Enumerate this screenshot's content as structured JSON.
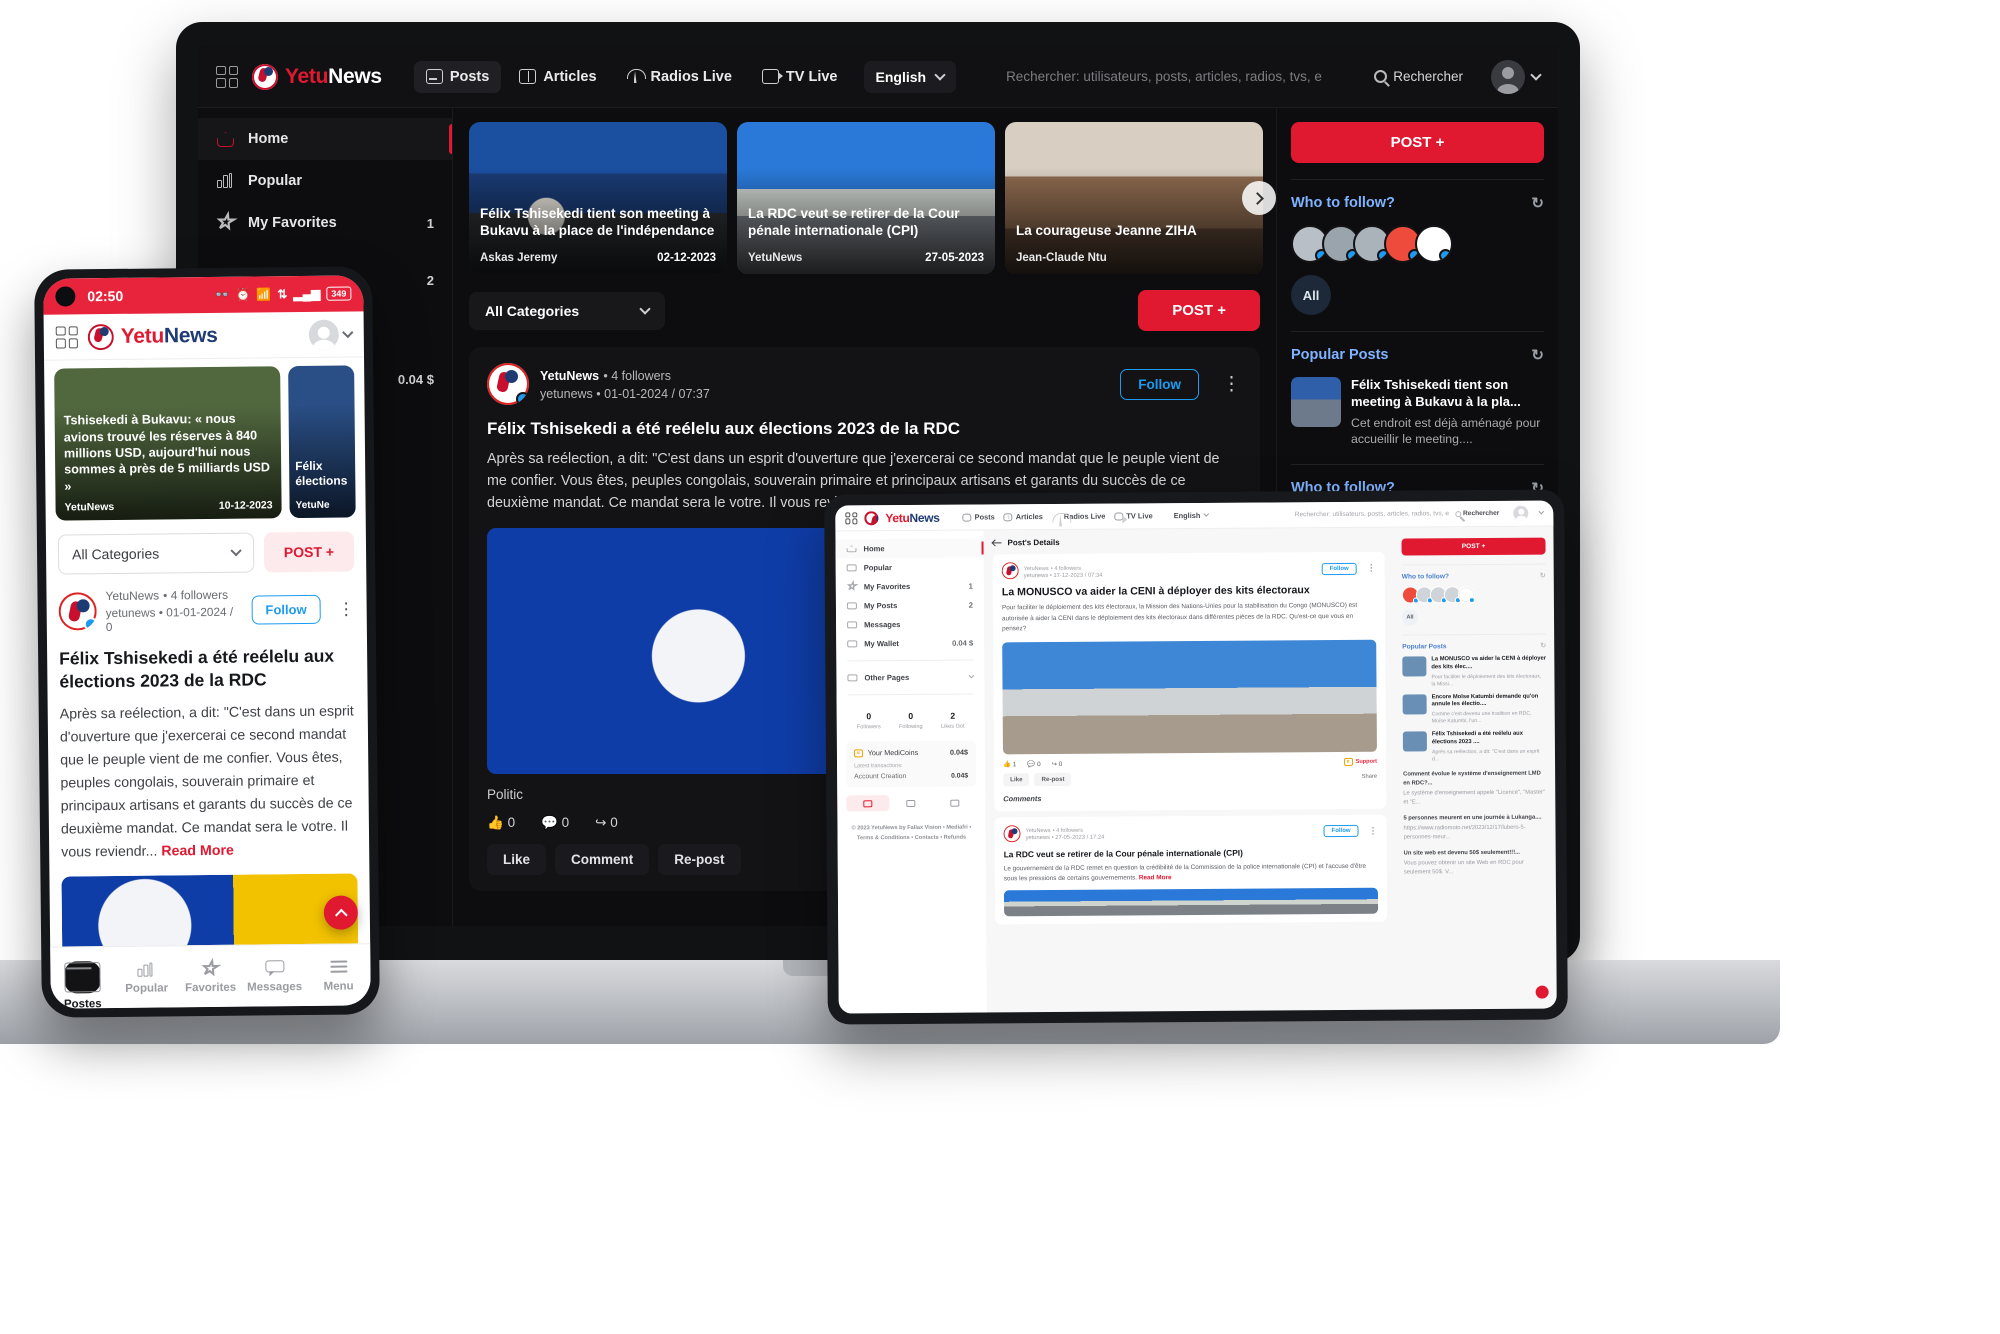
{
  "brand": {
    "name_part1": "Yetu",
    "name_part2": "News",
    "logo_icon": "yetunews-logo-icon"
  },
  "desktop": {
    "nav": [
      {
        "label": "Posts",
        "icon": "posts-icon",
        "active": true
      },
      {
        "label": "Articles",
        "icon": "articles-icon",
        "active": false
      },
      {
        "label": "Radios Live",
        "icon": "radio-icon",
        "active": false
      },
      {
        "label": "TV Live",
        "icon": "tv-icon",
        "active": false
      }
    ],
    "language": "English",
    "search": {
      "placeholder": "Rechercher: utilisateurs, posts, articles, radios, tvs, e",
      "button": "Rechercher"
    },
    "sidebar": [
      {
        "label": "Home",
        "icon": "home-icon",
        "count": "",
        "active": true
      },
      {
        "label": "Popular",
        "icon": "bars-icon",
        "count": "",
        "active": false
      },
      {
        "label": "My Favorites",
        "icon": "star-icon",
        "count": "1",
        "active": false
      },
      {
        "label": "My Posts",
        "icon": "card-icon",
        "count": "2",
        "active": false
      },
      {
        "label": "Messages",
        "icon": "message-icon",
        "count": "",
        "active": false
      },
      {
        "label": "My Wallet",
        "icon": "wallet-icon",
        "count": "0.04 $",
        "active": false
      }
    ],
    "stories": [
      {
        "title": "Félix Tshisekedi tient son meeting à Bukavu à la place de l'indépendance",
        "author": "Askas Jeremy",
        "date": "02-12-2023",
        "image": "img-rally"
      },
      {
        "title": "La RDC veut se retirer de la Cour pénale internationale (CPI)",
        "author": "YetuNews",
        "date": "27-05-2023",
        "image": "img-court"
      },
      {
        "title": "La courageuse Jeanne ZIHA",
        "author": "Jean-Claude Ntu",
        "date": "",
        "image": "img-room"
      }
    ],
    "category_filter": "All Categories",
    "post_button": "POST +",
    "feed_post": {
      "author": "YetuNews",
      "followers": "• 4 followers",
      "handle": "yetunews • 01-01-2024 / 07:37",
      "follow_label": "Follow",
      "title": "Félix Tshisekedi a été reélelu aux élections 2023 de la RDC",
      "body": "Après sa reélection, a dit: \"C'est dans un esprit d'ouverture que j'exercerai ce second mandat que le peuple vient de me confier. Vous êtes, peuples congolais, souverain primaire et principaux artisans et garants du succès de ce deuxième mandat. Ce mandat sera le votre. Il vous reviendr...",
      "read_more": "Read More",
      "category_tag": "Politic",
      "likes": "0",
      "comments": "0",
      "reposts": "0",
      "actions": [
        "Like",
        "Comment",
        "Re-post"
      ]
    },
    "right": {
      "post_button": "POST +",
      "who_to_follow": "Who to follow?",
      "all_label": "All",
      "popular_posts": "Popular Posts",
      "popular_item": {
        "title": "Félix Tshisekedi tient son meeting à Bukavu à la pla...",
        "excerpt": "Cet endroit est déjà aménagé pour accueillir le meeting...."
      },
      "who_to_follow2": "Who to follow?"
    }
  },
  "phone": {
    "status": {
      "time": "02:50",
      "battery": "349"
    },
    "hero": [
      {
        "title": "Tshisekedi à Bukavu: « nous avions trouvé les réserves à 840 millions USD, aujourd'hui nous sommes à près de 5 milliards USD »",
        "author": "YetuNews",
        "date": "10-12-2023"
      },
      {
        "title": "Félix élections",
        "author": "YetuNe",
        "date": ""
      }
    ],
    "category_filter": "All Categories",
    "post_button": "POST +",
    "post": {
      "author": "YetuNews",
      "followers": "• 4 followers",
      "handle": "yetunews • 01-01-2024 / 0",
      "follow_label": "Follow",
      "title": "Félix Tshisekedi a été reélelu aux élections 2023 de la RDC",
      "body": "Après sa reélection, a dit: \"C'est dans un esprit d'ouverture que j'exercerai ce second mandat que le peuple vient de me confier. Vous êtes, peuples congolais, souverain primaire et principaux artisans et garants du succès de ce deuxième mandat. Ce mandat sera le votre. Il vous reviendr...",
      "read_more": "Read More"
    },
    "tabs": [
      {
        "label": "Postes",
        "icon": "card-icon",
        "active": true
      },
      {
        "label": "Popular",
        "icon": "bars-icon",
        "active": false
      },
      {
        "label": "Favorites",
        "icon": "star-icon",
        "active": false
      },
      {
        "label": "Messages",
        "icon": "message-icon",
        "active": false
      },
      {
        "label": "Menu",
        "icon": "menu-icon",
        "active": false
      }
    ]
  },
  "tablet": {
    "nav": [
      {
        "label": "Posts",
        "icon": "posts-icon"
      },
      {
        "label": "Articles",
        "icon": "articles-icon"
      },
      {
        "label": "Radios Live",
        "icon": "radio-icon"
      },
      {
        "label": "TV Live",
        "icon": "tv-icon"
      }
    ],
    "language": "English",
    "search": {
      "placeholder": "Rechercher: utilisateurs, posts, articles, radios, tvs, e",
      "button": "Rechercher"
    },
    "sidebar": [
      {
        "label": "Home",
        "icon": "home-icon",
        "count": "",
        "active": true
      },
      {
        "label": "Popular",
        "icon": "bars-icon",
        "count": ""
      },
      {
        "label": "My Favorites",
        "icon": "star-icon",
        "count": "1"
      },
      {
        "label": "My Posts",
        "icon": "card-icon",
        "count": "2"
      },
      {
        "label": "Messages",
        "icon": "message-icon",
        "count": ""
      },
      {
        "label": "My Wallet",
        "icon": "wallet-icon",
        "count": "0.04 $"
      },
      {
        "label": "Other Pages",
        "icon": "list-icon",
        "count": ""
      }
    ],
    "stats": [
      {
        "value": "0",
        "label": "Followers"
      },
      {
        "value": "0",
        "label": "Following"
      },
      {
        "value": "2",
        "label": "Likes Got"
      }
    ],
    "wallet": {
      "title": "Your MediCoins",
      "balance": "0.04$",
      "latest_label": "Latest transactions:",
      "tx_label": "Account Creation",
      "tx_amount": "0.04$"
    },
    "footer_line1": "© 2023 YetuNews by Fallax Vision • Mediafri •",
    "footer_line2": "Terms & Conditions • Contacts • Refunds",
    "detail_header": "Post's Details",
    "post": {
      "author": "YetuNews",
      "followers": "• 4 followers",
      "handle": "yetunews • 17-12-2023 / 07:34",
      "follow_label": "Follow",
      "title": "La MONUSCO va aider la CENI à déployer des kits électoraux",
      "body": "Pour faciliter le déploiement des kits électoraux, la Mission des Nations-Unies pour la stabilisation du Congo (MONUSCO) est autorisée à aider la CENI dans le déploiement des kits électoraux dans différentes pièces de la RDC. Qu'est-ce que vous en pensez?",
      "likes": "1",
      "comments": "0",
      "reposts": "0",
      "support": "Support",
      "actions": [
        "Like",
        "Re-post"
      ],
      "share": "Share",
      "comments_title": "Comments"
    },
    "post2": {
      "author": "YetuNews",
      "followers": "• 4 followers",
      "handle": "yetunews • 27-05-2023 / 17:24",
      "follow_label": "Follow",
      "title": "La RDC veut se retirer de la Cour pénale internationale (CPI)",
      "body": "Le gouvernement de la RDC remet en question la crédibilité de la Commission de la police internationale (CPI) et l'accuse d'être sous les pressions de certains gouvernements.",
      "read_more": "Read More"
    },
    "right": {
      "post_button": "POST +",
      "who_to_follow": "Who to follow?",
      "all_label": "All",
      "popular_posts": "Popular Posts",
      "items": [
        {
          "title": "La MONUSCO va aider la CENI à déployer des kits élec....",
          "excerpt": "Pour faciliter le déploiement des kits électoraux, la Missi..."
        },
        {
          "title": "Encore Moïse Katumbi demande qu'on annule les électio....",
          "excerpt": "Comme c'est devenu une tradition en RDC, Moïse Katumbi, l'un..."
        },
        {
          "title": "Félix Tshisekedi a été reélelu aux élections 2023 ....",
          "excerpt": "Après sa reélection, a dit: \"C'est dans un esprit d..."
        }
      ],
      "links": [
        {
          "title": "Comment évolue le système d'enseignement LMD en RDC?...",
          "excerpt": "Le système d'enseignement appelé \"Licence\", \"Master\" et \"E..."
        },
        {
          "title": "5 personnes meurent en une journée à Lukanga....",
          "excerpt": "https://www.radiomoto.net/2023/12/17/lubero-5-personnes-meur..."
        },
        {
          "title": "Un site web est devenu 50$ seulement!!!...",
          "excerpt": "Vous pouvez obtenir un site Web en RDC pour seulement 50$. V..."
        }
      ]
    }
  }
}
